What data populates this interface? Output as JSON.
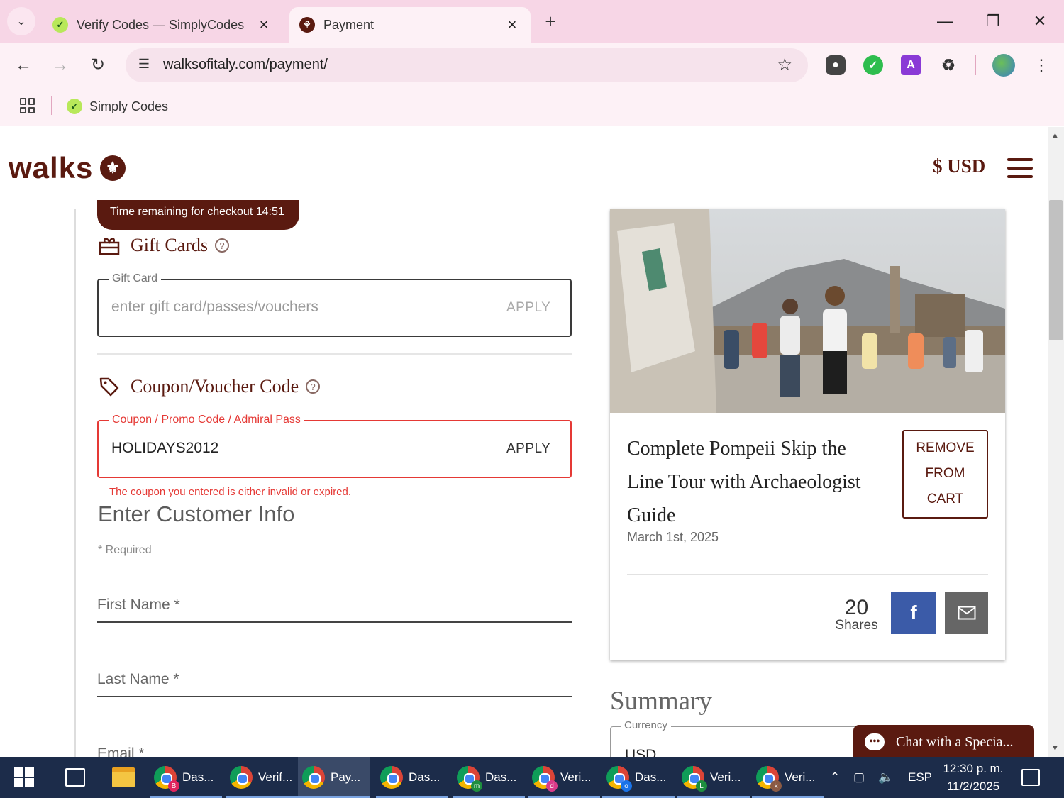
{
  "browser": {
    "tabs": [
      {
        "title": "Verify Codes — SimplyCodes",
        "active": false,
        "favicon": "simplycodes-icon"
      },
      {
        "title": "Payment",
        "active": true,
        "favicon": "walks-icon"
      }
    ],
    "url": "walksofitaly.com/payment/",
    "bookmarks": [
      {
        "label": "Simply Codes"
      }
    ],
    "ext_letter": "A"
  },
  "site": {
    "brand": "walks",
    "currency": "$ USD"
  },
  "checkout": {
    "timer": "Time remaining for checkout 14:51",
    "gift_cards": {
      "title": "Gift Cards",
      "legend": "Gift Card",
      "placeholder": "enter gift card/passes/vouchers",
      "apply": "APPLY"
    },
    "coupon": {
      "title": "Coupon/Voucher Code",
      "legend": "Coupon / Promo Code / Admiral Pass",
      "value": "HOLIDAYS2012",
      "apply": "APPLY",
      "error": "The coupon you entered is either invalid or expired."
    },
    "customer": {
      "title": "Enter Customer Info",
      "required_note": "* Required",
      "first_name": "First Name *",
      "last_name": "Last Name *",
      "email": "Email *"
    }
  },
  "cart_item": {
    "title": "Complete Pompeii Skip the Line Tour with Archaeologist Guide",
    "date": "March 1st, 2025",
    "remove_line1": "REMOVE",
    "remove_line2": "FROM",
    "remove_line3": "CART",
    "shares_count": "20",
    "shares_label": "Shares",
    "facebook_glyph": "f"
  },
  "summary": {
    "title": "Summary",
    "currency_legend": "Currency",
    "currency_value": "USD"
  },
  "chat": {
    "label": "Chat with a Specia..."
  },
  "taskbar": {
    "apps": [
      {
        "label": "Das...",
        "badge": "B",
        "badge_color": "#e0245e"
      },
      {
        "label": "Verif...",
        "badge": "",
        "badge_color": ""
      },
      {
        "label": "Pay...",
        "badge": "",
        "badge_color": ""
      },
      {
        "label": "Das...",
        "badge": "",
        "badge_color": ""
      },
      {
        "label": "Das...",
        "badge": "m",
        "badge_color": "#1e8e3e"
      },
      {
        "label": "Veri...",
        "badge": "d",
        "badge_color": "#d93b8a"
      },
      {
        "label": "Das...",
        "badge": "o",
        "badge_color": "#1a73e8"
      },
      {
        "label": "Veri...",
        "badge": "L",
        "badge_color": "#1e8e3e"
      },
      {
        "label": "Veri...",
        "badge": "k",
        "badge_color": "#8a5a44"
      }
    ],
    "language": "ESP",
    "time": "12:30 p. m.",
    "date": "11/2/2025"
  }
}
